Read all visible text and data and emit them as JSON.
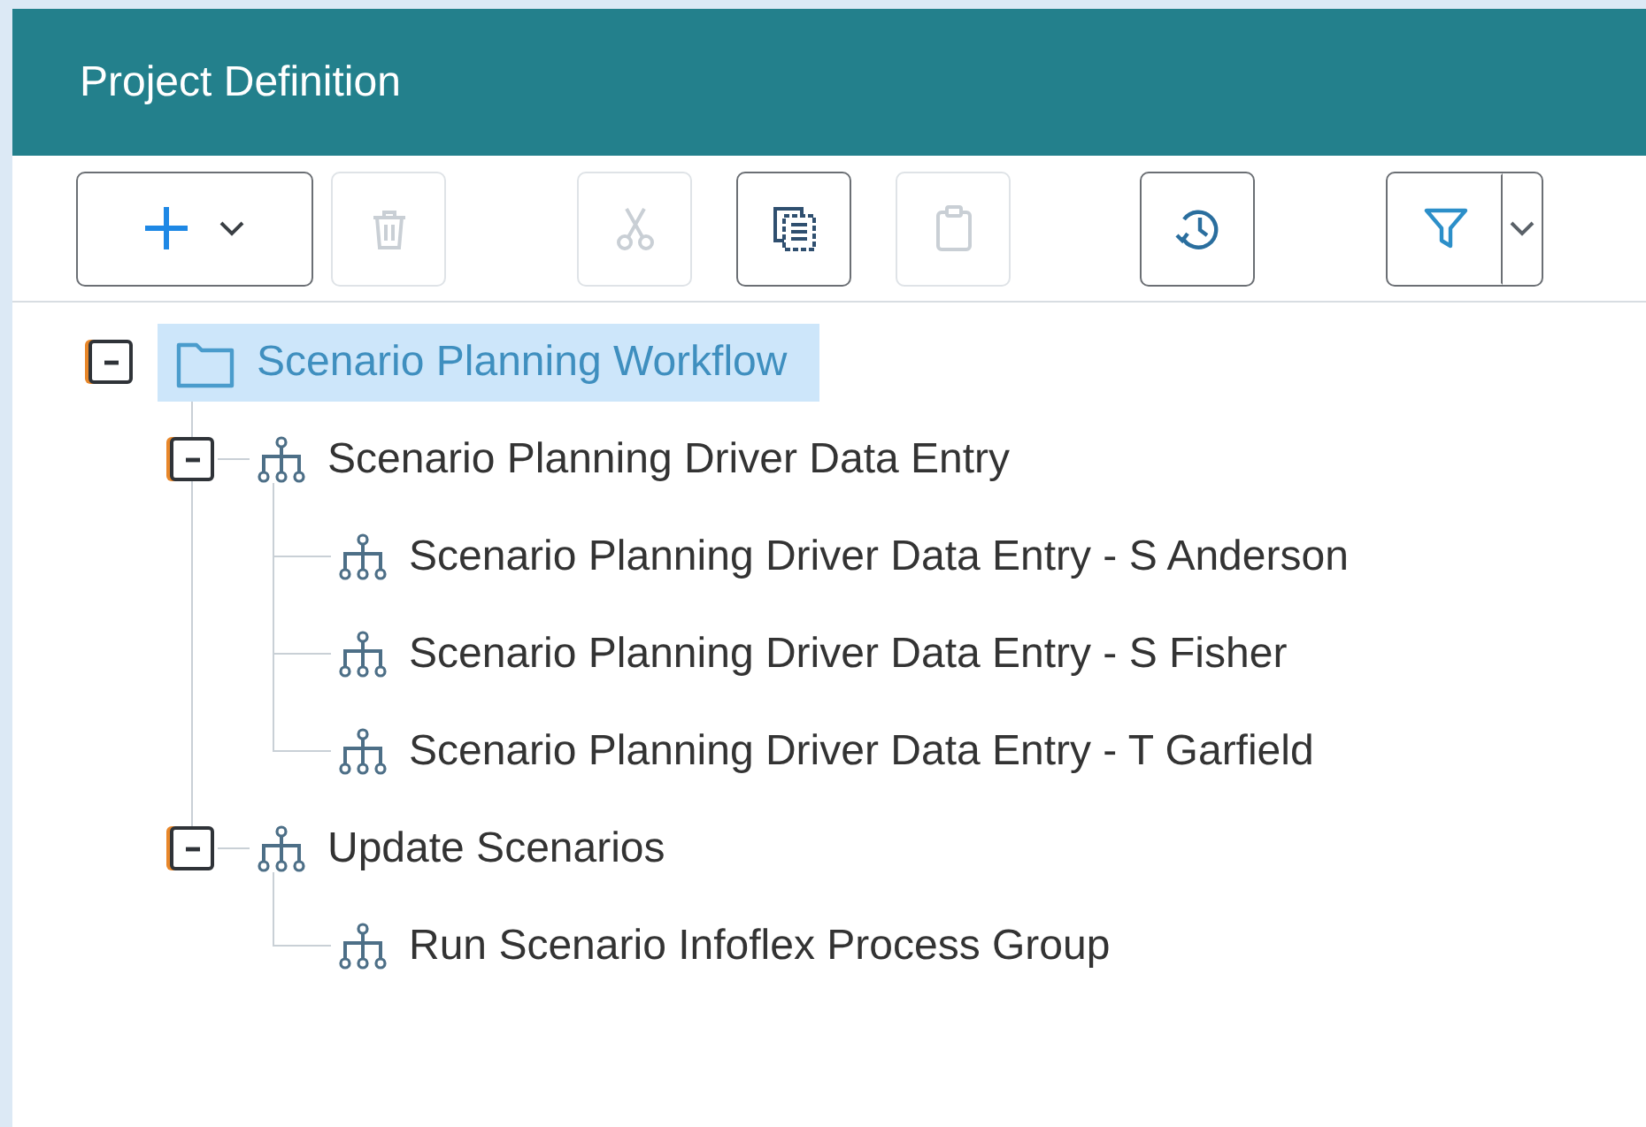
{
  "panel": {
    "title": "Project Definition"
  },
  "toolbar": [
    {
      "kind": "add",
      "disabled": false
    },
    {
      "kind": "delete",
      "disabled": true
    },
    {
      "kind": "cut",
      "disabled": true
    },
    {
      "kind": "copy",
      "disabled": false
    },
    {
      "kind": "paste",
      "disabled": true
    },
    {
      "kind": "history",
      "disabled": false
    },
    {
      "kind": "filter",
      "disabled": false
    }
  ],
  "tree": [
    {
      "label": "Scenario Planning Workflow",
      "kind": "folder",
      "selected": true,
      "expanded": true,
      "children": [
        {
          "label": "Scenario Planning Driver Data Entry",
          "kind": "workflow",
          "selected": false,
          "expanded": true,
          "children": [
            {
              "label": "Scenario Planning Driver Data Entry - S Anderson",
              "kind": "workflow",
              "selected": false
            },
            {
              "label": "Scenario Planning Driver Data Entry - S Fisher",
              "kind": "workflow",
              "selected": false
            },
            {
              "label": "Scenario Planning Driver Data Entry - T Garfield",
              "kind": "workflow",
              "selected": false
            }
          ]
        },
        {
          "label": "Update Scenarios",
          "kind": "workflow",
          "selected": false,
          "expanded": true,
          "children": [
            {
              "label": "Run Scenario Infoflex Process Group",
              "kind": "workflow",
              "selected": false
            }
          ]
        }
      ]
    }
  ]
}
